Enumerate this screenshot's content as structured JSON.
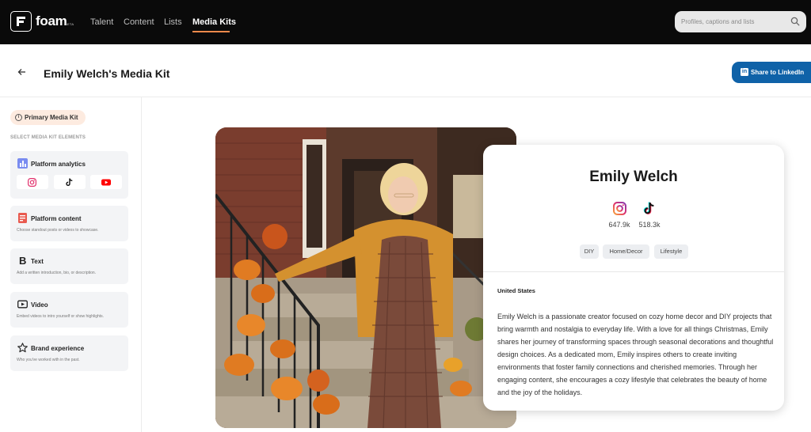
{
  "nav": {
    "logo_text": "foam",
    "logo_badge": "BETA",
    "items": [
      {
        "label": "Talent"
      },
      {
        "label": "Content"
      },
      {
        "label": "Lists"
      },
      {
        "label": "Media Kits"
      }
    ],
    "active": "Media Kits",
    "search_placeholder": "Profiles, captions and lists"
  },
  "header": {
    "title": "Emily Welch's Media Kit",
    "share_label": "Share to LinkedIn"
  },
  "sidebar": {
    "pill_label": "Primary Media Kit",
    "section_label": "SELECT MEDIA KIT ELEMENTS",
    "cards": [
      {
        "title": "Platform analytics",
        "description": "",
        "icon": "bar-chart-icon"
      },
      {
        "title": "Platform content",
        "description": "Choose standout posts or videos to showcase.",
        "icon": "content-icon"
      },
      {
        "title": "Text",
        "description": "Add a written introduction, bio, or description.",
        "icon": "text-icon"
      },
      {
        "title": "Video",
        "description": "Embed videos to intro yourself or show highlights.",
        "icon": "video-icon"
      },
      {
        "title": "Brand experience",
        "description": "Who you've worked with in the past.",
        "icon": "star-icon"
      }
    ],
    "platforms": [
      "instagram",
      "tiktok",
      "youtube"
    ]
  },
  "profile": {
    "name": "Emily Welch",
    "socials": [
      {
        "platform": "instagram",
        "followers": "647.9k"
      },
      {
        "platform": "tiktok",
        "followers": "518.3k"
      }
    ],
    "tags": [
      "DIY",
      "Home/Decor",
      "Lifestyle"
    ],
    "location": "United States",
    "bio": "Emily Welch is a passionate creator focused on cozy home decor and DIY projects that bring warmth and nostalgia to everyday life. With a love for all things Christmas, Emily shares her journey of transforming spaces through seasonal decorations and thoughtful design choices. As a dedicated mom, Emily inspires others to create inviting environments that foster family connections and cherished memories. Through her engaging content, she encourages a cozy lifestyle that celebrates the beauty of home and the joy of the holidays."
  },
  "colors": {
    "topbar": "#0a0a0a",
    "accent": "#f08a4b",
    "linkedin": "#0f62a8",
    "instagram": "#e1306c",
    "youtube": "#ff0000"
  }
}
